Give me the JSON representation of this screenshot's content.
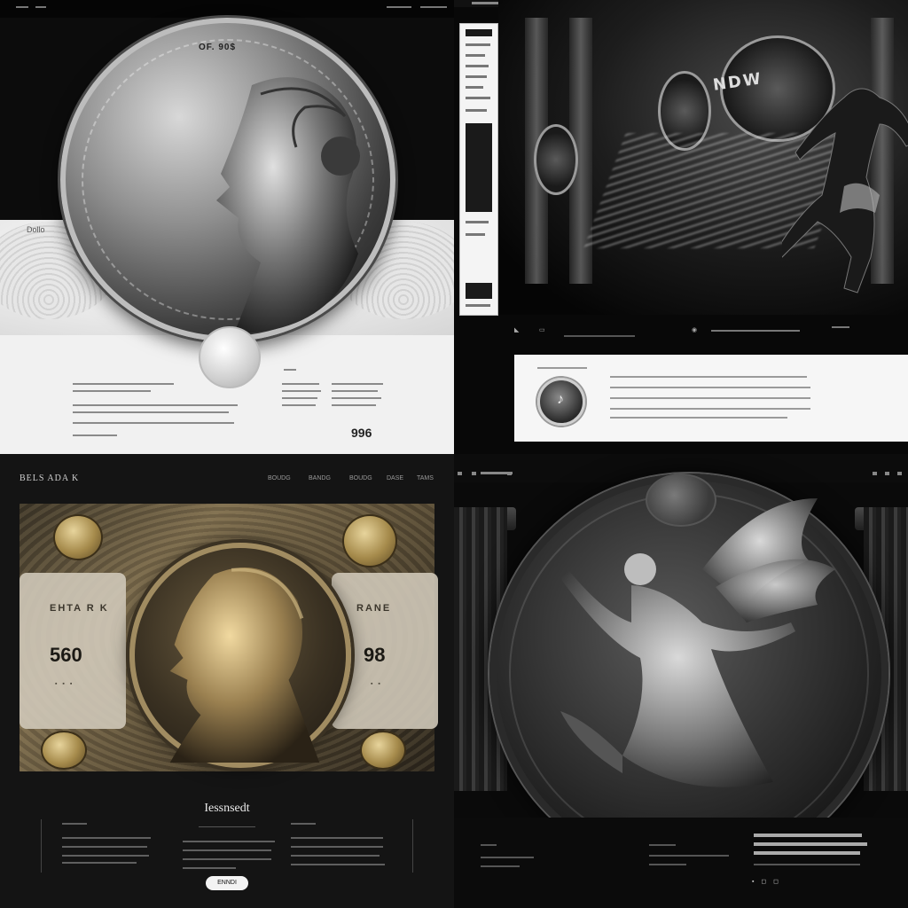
{
  "panel1": {
    "coin_text": "OF. 90$",
    "wing_label": "Dollo",
    "number_badge": "996"
  },
  "panel2": {
    "disc_text": "NDW",
    "card_icon": "♪"
  },
  "panel3": {
    "brand": "BELS ADA K",
    "nav": [
      "BOUDG",
      "BANDG",
      "BOUDG",
      "DASE",
      "TAMS"
    ],
    "note_left_label": "EHTA R K",
    "note_left_value": "560",
    "note_right_label": "RANE",
    "note_right_value": "98",
    "heading": "Iessnsedt",
    "button_label": "ENNDI"
  },
  "panel4": {
    "pager": "▪ ◻ ◻"
  },
  "colors": {
    "panel1_bg": "#f1f1f1",
    "panel3_gold": "#a18c61",
    "dark": "#0a0a0a"
  }
}
